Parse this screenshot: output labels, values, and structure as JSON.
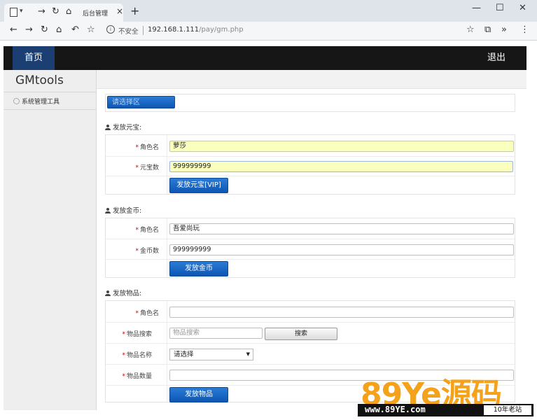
{
  "browser": {
    "tab_title": "后台管理",
    "tab_close": "×",
    "new_tab": "+",
    "insecure_label": "不安全",
    "url_host": "192.168.1.111",
    "url_path": "/pay/gm.php",
    "icons": [
      "back-icon",
      "forward-icon",
      "reload-icon",
      "home-icon",
      "undo-icon",
      "star-icon",
      "crop-icon",
      "chevron-icon",
      "menu-icon"
    ]
  },
  "topnav": {
    "home": "首页",
    "logout": "退出"
  },
  "sidebar": {
    "brand": "GMtools",
    "items": [
      {
        "label": "系统管理工具"
      }
    ]
  },
  "server_select": {
    "label": "请选择区"
  },
  "sections": {
    "yuanbao": {
      "title": "发放元宝:",
      "role_label": "角色名",
      "role_value": "萝莎",
      "amount_label": "元宝数",
      "amount_value": "999999999",
      "button": "发放元宝[VIP]"
    },
    "gold": {
      "title": "发放金币:",
      "role_label": "角色名",
      "role_value": "吾爱尚玩",
      "amount_label": "金币数",
      "amount_value": "999999999",
      "button": "发放金币"
    },
    "items": {
      "title": "发放物品:",
      "role_label": "角色名",
      "role_value": "",
      "search_label": "物品搜索",
      "search_placeholder": "物品搜索",
      "search_button": "搜索",
      "name_label": "物品名称",
      "name_select": "请选择",
      "qty_label": "物品数量",
      "qty_value": "",
      "button": "发放物品"
    }
  },
  "required_mark": "*",
  "watermark": {
    "big": "89Ye",
    "cn": "源码",
    "url": "www.89YE.com",
    "tag": "10年老站"
  }
}
